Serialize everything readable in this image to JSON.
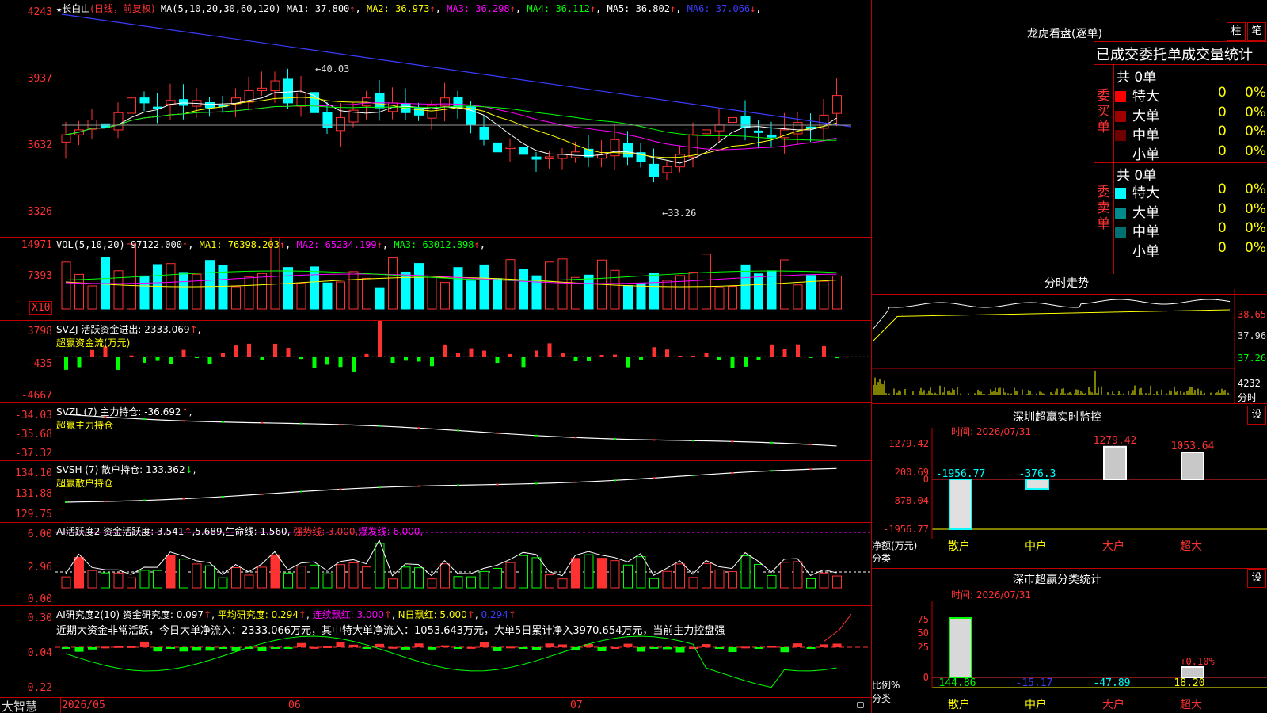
{
  "stock": {
    "star": "★",
    "name": "长白山",
    "period": "(日线，前复权)"
  },
  "main_ma": {
    "label": "MA(5,10,20,30,60,120)",
    "items": [
      {
        "text": "MA1: 37.800",
        "arrow": "↑",
        "color": "#ffffff"
      },
      {
        "text": "MA2: 36.973",
        "arrow": "↑",
        "color": "#ffff00"
      },
      {
        "text": "MA3: 36.298",
        "arrow": "↑",
        "color": "#ff00ff"
      },
      {
        "text": "MA4: 36.112",
        "arrow": "↑",
        "color": "#00ff00"
      },
      {
        "text": "MA5: 36.802",
        "arrow": "↑",
        "color": "#ffffff"
      },
      {
        "text": "MA6: 37.066",
        "arrow": "↓",
        "color": "#3c3cff"
      }
    ],
    "y_labels": [
      "4243",
      "3937",
      "3632",
      "3326"
    ],
    "high_mark": "40.03",
    "low_mark": "33.26"
  },
  "vol": {
    "label": "VOL(5,10,20)",
    "value": "97122.000",
    "arrow": "↑",
    "items": [
      {
        "text": "MA1: 76398.203",
        "arrow": "↑",
        "color": "#ffff00"
      },
      {
        "text": "MA2: 65234.199",
        "arrow": "↑",
        "color": "#ff00ff"
      },
      {
        "text": "MA3: 63012.898",
        "arrow": "↑",
        "color": "#00ff00"
      }
    ],
    "y_labels": [
      "14971",
      "7393"
    ],
    "unit": "X10"
  },
  "svzj": {
    "title": "SVZJ  活跃资金进出: 2333.069",
    "arrow": "↑",
    "subtitle": "超赢资金流(万元)",
    "y_labels": [
      "3798",
      "-435",
      "-4667"
    ]
  },
  "svzl": {
    "title": "SVZL (7) 主力持仓: -36.692",
    "arrow": "↑",
    "tail": ",",
    "subtitle": "超赢主力持仓",
    "y_labels": [
      "-34.03",
      "-35.68",
      "-37.32"
    ]
  },
  "svsh": {
    "title": "SVSH (7) 散户持仓: 133.362",
    "arrow": "↓",
    "tail": ",",
    "subtitle": "超赢散户持仓",
    "y_labels": [
      "134.10",
      "131.88",
      "129.75"
    ]
  },
  "ai_active": {
    "title": "AI活跃度2 资金活跃度: 3.541",
    "a1": "↑",
    "v2": ",5.689,",
    "v3": "生命线: 1.560,",
    "v4": "强势线: 3.000,",
    "v5": "爆发线: 6.000,",
    "y_labels": [
      "6.00",
      "2.96",
      "0.00"
    ]
  },
  "ai_research": {
    "title": "AI研究度2(10) 资金研究度: 0.097",
    "a1": "↑",
    "v2": "平均研究度: 0.294",
    "a2": "↑",
    "v3": "连续飘红: 3.000",
    "a3": "↑",
    "v4": "N日飘红: 5.000",
    "a4": "↑",
    "v5": "0.294",
    "a5": "↑",
    "note": "近期大资金非常活跃，今日大单净流入：2333.066万元，其中特大单净流入：1053.643万元，大单5日累计净入3970.654万元，当前主力控盘强",
    "y_labels": [
      "0.30",
      "0.04",
      "-0.22"
    ]
  },
  "bottom": {
    "brand": "大智慧",
    "dates": [
      "2026/05",
      "06",
      "07"
    ]
  },
  "lhb": {
    "title": "龙虎看盘(逐单)",
    "btn_zhu": "柱",
    "btn_bi": "笔",
    "subtitle": "已成交委托单成交量统计",
    "buy_label": "委买单",
    "sell_label": "委卖单",
    "buy_total": "共 0单",
    "sell_total": "共 0单",
    "buy_rows": [
      {
        "name": "特大",
        "count": "0",
        "pct": "0%",
        "color": "#ff0000"
      },
      {
        "name": "大单",
        "count": "0",
        "pct": "0%",
        "color": "#a00000"
      },
      {
        "name": "中单",
        "count": "0",
        "pct": "0%",
        "color": "#6e0000"
      },
      {
        "name": "小单",
        "count": "0",
        "pct": "0%",
        "color": "#000000"
      }
    ],
    "sell_rows": [
      {
        "name": "特大",
        "count": "0",
        "pct": "0%",
        "color": "#00ffff"
      },
      {
        "name": "大单",
        "count": "0",
        "pct": "0%",
        "color": "#008c8c"
      },
      {
        "name": "中单",
        "count": "0",
        "pct": "0%",
        "color": "#007070"
      },
      {
        "name": "小单",
        "count": "0",
        "pct": "0%",
        "color": "#000000"
      }
    ]
  },
  "intraday": {
    "title": "分时走势",
    "y_labels": [
      "38.65",
      "37.96",
      "37.26"
    ],
    "vol_label": "4232",
    "vol_unit": "分时"
  },
  "sz_monitor": {
    "title": "深圳超赢实时监控",
    "btn": "设",
    "time": "时间: 2026/07/31",
    "y_labels": [
      "1279.42",
      "200.69",
      "0",
      "-878.04",
      "-1956.77"
    ],
    "cats": [
      "散户",
      "中户",
      "大户",
      "超大"
    ],
    "values": [
      "-1956.77",
      "-376.3",
      "1279.42",
      "1053.64"
    ],
    "axis_title1": "净额(万元)",
    "axis_title2": "分类"
  },
  "sz_class": {
    "title": "深市超赢分类统计",
    "btn": "设",
    "time": "时间: 2026/07/31",
    "y_labels": [
      "75",
      "50",
      "25",
      "0"
    ],
    "cats": [
      "散户",
      "中户",
      "大户",
      "超大"
    ],
    "values": [
      "144.86",
      "-15.17",
      "-47.89",
      "18.20"
    ],
    "bar_note": "+0.10%",
    "axis_title1": "比例%",
    "axis_title2": "分类"
  },
  "colors": {
    "up": "#ff3232",
    "down": "#00ffff",
    "grid": "#c00000",
    "green": "#00ff00",
    "yellow": "#ffff00",
    "magenta": "#ff00ff",
    "blue": "#3c3cff"
  }
}
